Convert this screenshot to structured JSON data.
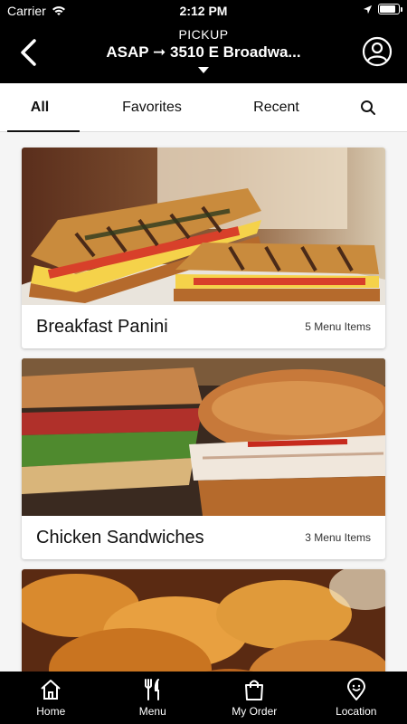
{
  "status_bar": {
    "carrier": "Carrier",
    "time": "2:12 PM",
    "battery_level": 0.9
  },
  "header": {
    "pickup_label": "PICKUP",
    "location_text": "ASAP ➞ 3510 E Broadwa..."
  },
  "tabs": [
    {
      "label": "All"
    },
    {
      "label": "Favorites"
    },
    {
      "label": "Recent"
    }
  ],
  "categories": [
    {
      "title": "Breakfast Panini",
      "count": "5 Menu Items"
    },
    {
      "title": "Chicken Sandwiches",
      "count": "3 Menu Items"
    }
  ],
  "bottom_nav": [
    {
      "label": "Home",
      "icon": "home-icon"
    },
    {
      "label": "Menu",
      "icon": "fork-knife-icon"
    },
    {
      "label": "My Order",
      "icon": "bag-icon"
    },
    {
      "label": "Location",
      "icon": "location-pin-icon"
    }
  ],
  "colors": {
    "header_bg": "#000000",
    "accent": "#111111"
  }
}
